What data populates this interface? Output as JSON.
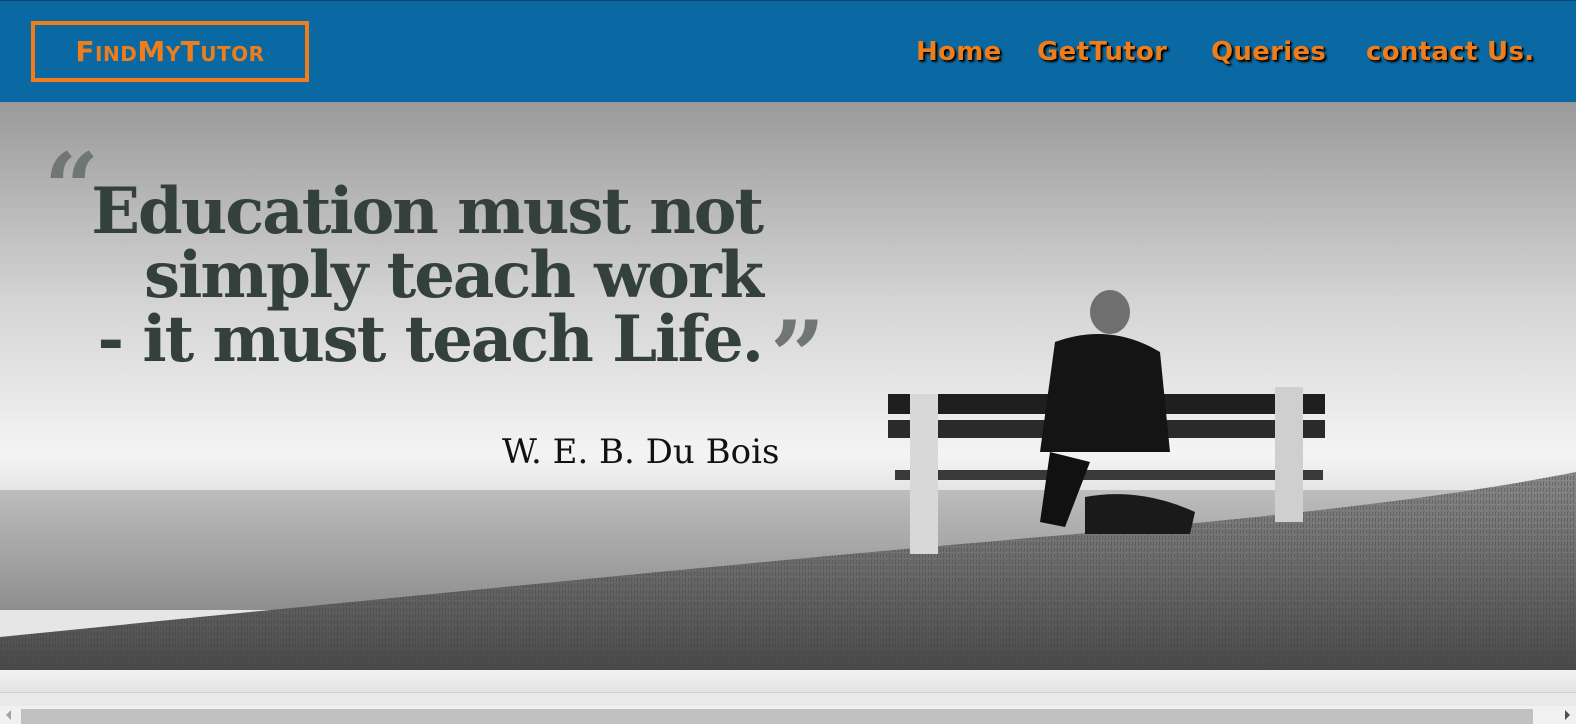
{
  "header": {
    "logo_text": "FindMyTutor",
    "nav": [
      "Home",
      "GetTutor",
      "Queries",
      "contact Us."
    ]
  },
  "hero": {
    "quote_lines": [
      "Education must not",
      "simply teach work",
      "- it must teach Life."
    ],
    "open_mark": "“",
    "close_mark": "”",
    "author": "W. E. B. Du Bois"
  },
  "colors": {
    "header_bg": "#0a69a3",
    "accent": "#ee7d1a",
    "quote_text": "#34403e"
  },
  "icons": [
    "scroll-left-arrow-icon",
    "scroll-right-arrow-icon"
  ]
}
